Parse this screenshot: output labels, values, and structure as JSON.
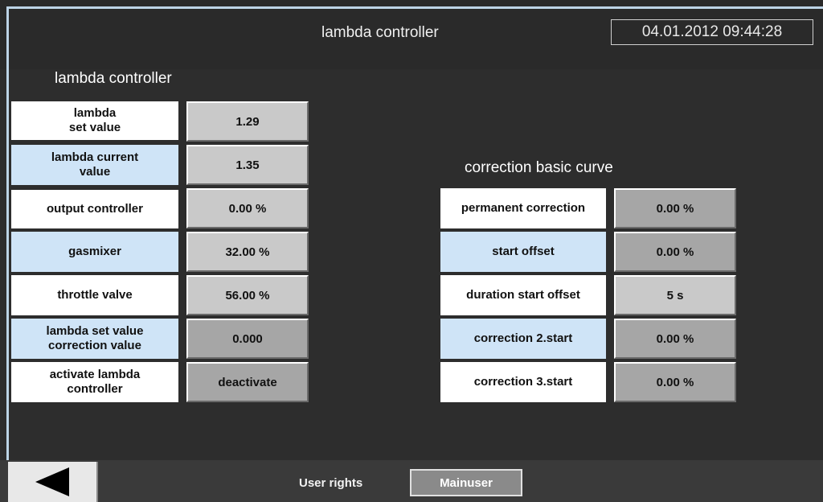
{
  "header": {
    "title": "lambda controller",
    "datetime": "04.01.2012 09:44:28"
  },
  "left_panel": {
    "title": "lambda controller",
    "rows": [
      {
        "label": "lambda\nset value",
        "value": "1.29"
      },
      {
        "label": "lambda current\nvalue",
        "value": "1.35"
      },
      {
        "label": "output controller",
        "value": "0.00 %"
      },
      {
        "label": "gasmixer",
        "value": "32.00 %"
      },
      {
        "label": "throttle valve",
        "value": "56.00 %"
      },
      {
        "label": "lambda set value\ncorrection value",
        "value": "0.000"
      },
      {
        "label": "activate lambda\ncontroller",
        "value": "deactivate"
      }
    ]
  },
  "right_panel": {
    "title": "correction basic curve",
    "rows": [
      {
        "label": "permanent correction",
        "value": "0.00 %"
      },
      {
        "label": "start offset",
        "value": "0.00 %"
      },
      {
        "label": "duration start offset",
        "value": "5 s"
      },
      {
        "label": "correction 2.start",
        "value": "0.00 %"
      },
      {
        "label": "correction 3.start",
        "value": "0.00 %"
      }
    ]
  },
  "footer": {
    "user_rights_label": "User rights",
    "user_button": "Mainuser"
  },
  "icons": {
    "back": "back-arrow-icon"
  }
}
